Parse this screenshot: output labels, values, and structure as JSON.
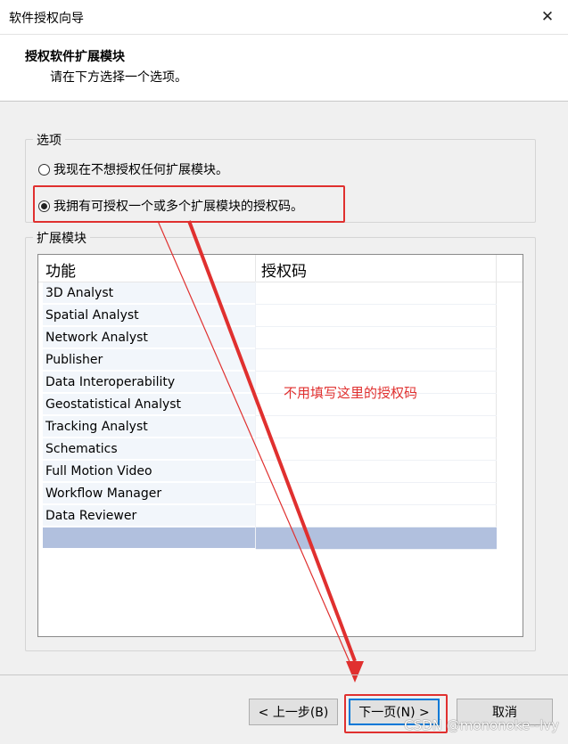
{
  "window": {
    "title": "软件授权向导"
  },
  "header": {
    "title": "授权软件扩展模块",
    "subtitle": "请在下方选择一个选项。"
  },
  "options": {
    "legend": "选项",
    "radio1_label": "我现在不想授权任何扩展模块。",
    "radio2_label": "我拥有可授权一个或多个扩展模块的授权码。",
    "selected": 2
  },
  "extensions": {
    "legend": "扩展模块",
    "columns": [
      "功能",
      "授权码"
    ],
    "rows": [
      "3D Analyst",
      "Spatial Analyst",
      "Network Analyst",
      "Publisher",
      "Data Interoperability",
      "Geostatistical Analyst",
      "Tracking Analyst",
      "Schematics",
      "Full Motion Video",
      "Workflow Manager",
      "Data Reviewer",
      ""
    ]
  },
  "annotation": {
    "text": "不用填写这里的授权码"
  },
  "buttons": {
    "back": "< 上一步(B)",
    "next": "下一页(N) >",
    "cancel": "取消"
  },
  "watermark": "CSDN @mononoke--lvy",
  "colors": {
    "accent": "#0078d7",
    "annotation": "#e0302f",
    "selected_row": "#b1c0de"
  }
}
